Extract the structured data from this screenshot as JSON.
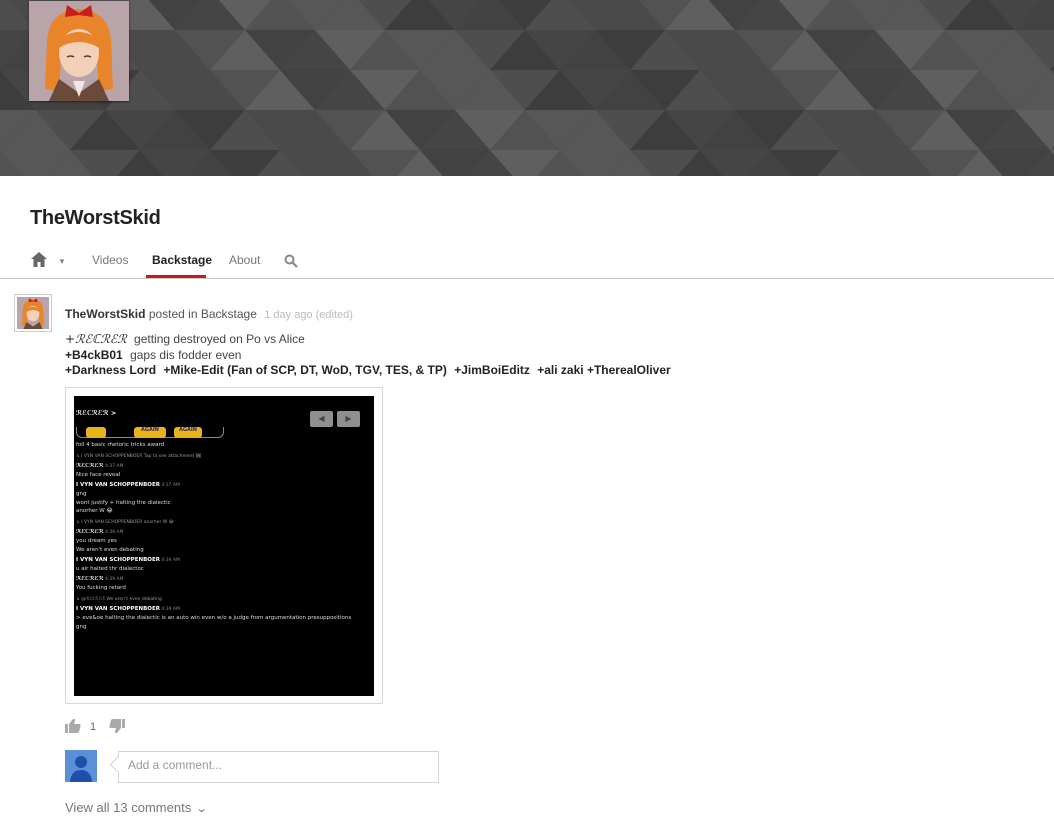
{
  "channel": {
    "title": "TheWorstSkid"
  },
  "tabs": [
    {
      "label": "Videos"
    },
    {
      "label": "Backstage",
      "active": true
    },
    {
      "label": "About"
    }
  ],
  "icons": {
    "home": "home-icon",
    "dropdown": "caret-down-icon",
    "search": "search-icon",
    "like": "thumbs-up-icon",
    "dislike": "thumbs-down-icon",
    "expand": "chevron-down-icon"
  },
  "post": {
    "author": "TheWorstSkid",
    "posted_in": "posted in Backstage",
    "time": "1 day ago (edited)",
    "line1": {
      "mention": "+ℛℰℂℛℰℛ",
      "text": "getting destroyed on Po vs Alice"
    },
    "line2": {
      "mention": "+B4ckB01",
      "text": "gaps dis fodder even"
    },
    "line3": [
      "+Darkness Lord",
      "+Mike-Edit (Fan of SCP, DT, WoD, TGV, TES, & TP)",
      "+JimBoiEditz",
      "+ali zaki",
      "+TherealOliver"
    ],
    "like_count": "1"
  },
  "attachment": {
    "header": "ℛℰℂℛℰℛ >",
    "badge1": "AGAIN",
    "badge2": "AGAIN",
    "lines": [
      {
        "kind": "text",
        "text": "foll 4 basic rhetoric tricks award"
      },
      {
        "kind": "meta",
        "text": "↳ I VYN VAN SCHOPPENBOER  Tap to see attachment 🖼"
      },
      {
        "kind": "name",
        "name": "ℛℰℂℛℰℛ",
        "time": "4:37 AM"
      },
      {
        "kind": "text",
        "text": "Nice face reveal"
      },
      {
        "kind": "name",
        "name": "I VYN VAN SCHOPPENBOER",
        "time": "4:37 AM"
      },
      {
        "kind": "text",
        "text": "gng"
      },
      {
        "kind": "text",
        "text": "wont justify + halting the dialectic"
      },
      {
        "kind": "text",
        "text": "anorher W 😂"
      },
      {
        "kind": "meta",
        "text": "↳ I VYN VAN SCHOPPENBOER  anorher W 😂"
      },
      {
        "kind": "name",
        "name": "ℛℰℂℛℰℛ",
        "time": "4:38 AM"
      },
      {
        "kind": "text",
        "text": "you dream yes"
      },
      {
        "kind": "text",
        "text": "We aren't even debating"
      },
      {
        "kind": "name",
        "name": "I VYN VAN SCHOPPENBOER",
        "time": "4:39 AM"
      },
      {
        "kind": "text",
        "text": "u air halted thr dialectoc"
      },
      {
        "kind": "name",
        "name": "ℛℰℂℛℰℛ",
        "time": "4:39 AM"
      },
      {
        "kind": "text",
        "text": "You fucking retard"
      },
      {
        "kind": "meta",
        "text": "↳ @ℛℰℂℛℰℛ  We aren't even debating"
      },
      {
        "kind": "name",
        "name": "I VYN VAN SCHOPPENBOER",
        "time": "4:39 AM"
      },
      {
        "kind": "text",
        "text": "> eve&oe halting the dialectic is an auto win even w/o a judge from argumentation presuppositions"
      },
      {
        "kind": "text",
        "text": "gng"
      }
    ]
  },
  "comments": {
    "placeholder": "Add a comment...",
    "view_all": "View all 13 comments"
  },
  "colors": {
    "accent": "#cc181e",
    "banner": "#4a4a4a",
    "viewer_avatar": "#5b8fd8"
  }
}
